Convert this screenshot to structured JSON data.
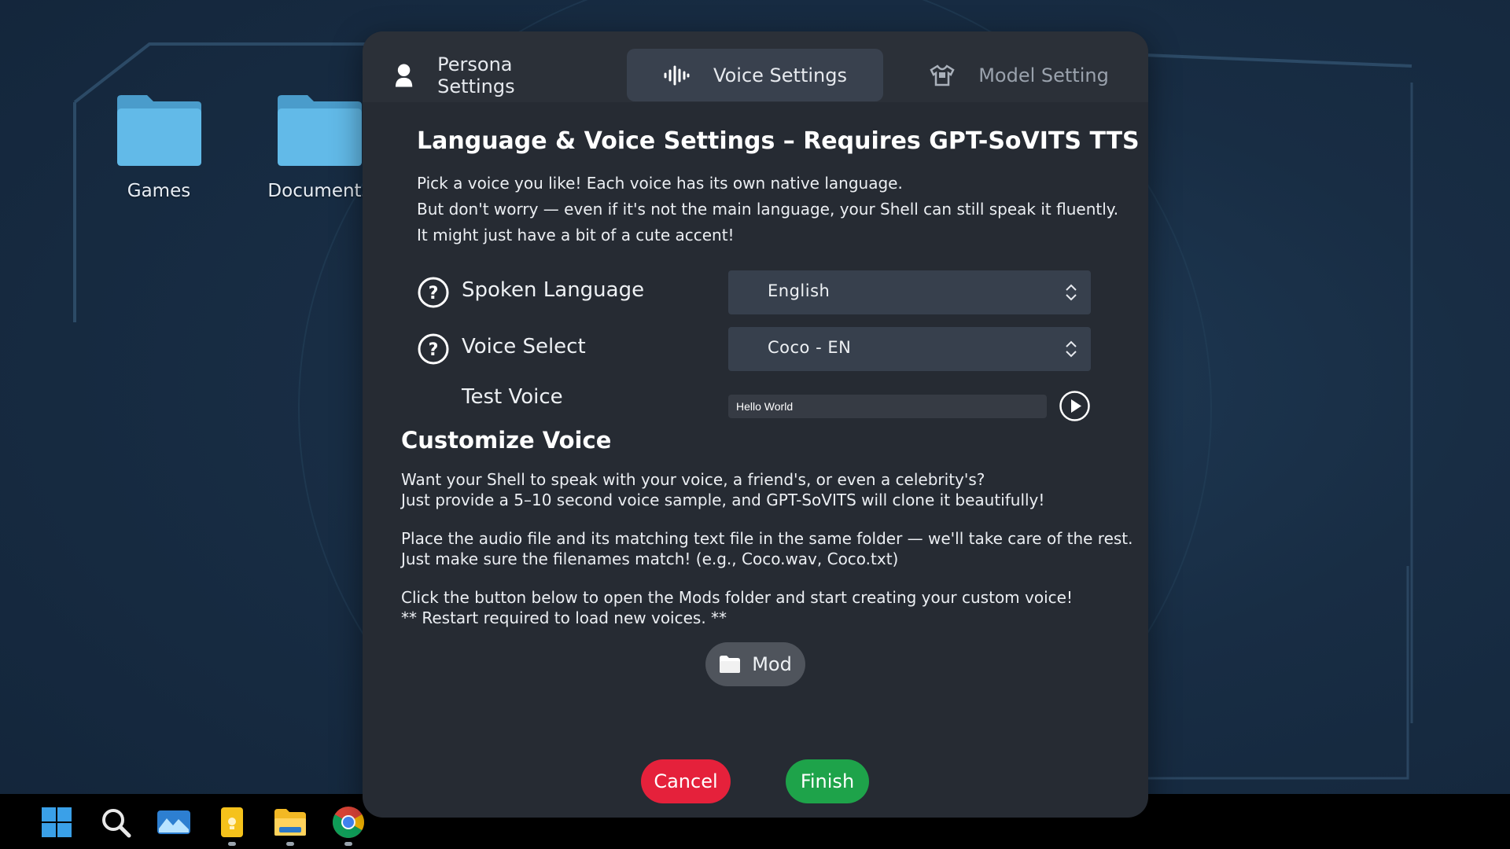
{
  "desktop": {
    "icons": [
      {
        "label": "Games"
      },
      {
        "label": "Documents"
      }
    ]
  },
  "taskbar": {
    "items": [
      "windows-start-icon",
      "search-icon",
      "photos-app-icon",
      "notes-app-icon",
      "file-explorer-icon",
      "chrome-browser-icon"
    ]
  },
  "tabs": [
    {
      "label": "Persona Settings",
      "icon": "person-icon"
    },
    {
      "label": "Voice Settings",
      "icon": "soundwave-icon",
      "active": true
    },
    {
      "label": "Model Setting",
      "icon": "shirt-icon"
    }
  ],
  "voice": {
    "title": "Language & Voice Settings – Requires GPT-SoVITS TTS",
    "intro": [
      "Pick a voice you like! Each voice has its own native language.",
      "But don't worry — even if it's not the main language, your Shell can still speak it fluently.",
      "It might just have a bit of a cute accent!"
    ],
    "spoken_language": {
      "label": "Spoken Language",
      "value": "English"
    },
    "voice_select": {
      "label": "Voice Select",
      "value": "Coco - EN"
    },
    "test_voice": {
      "label": "Test Voice",
      "value": "Hello World"
    }
  },
  "customize": {
    "title": "Customize Voice",
    "paragraphs": [
      [
        "Want your Shell to speak with your voice, a friend's, or even a celebrity's?",
        "Just provide a 5–10 second voice sample, and GPT-SoVITS will clone it beautifully!"
      ],
      [
        "Place the audio file and its matching text file in the same folder — we'll take care of the rest.",
        "Just make sure the filenames match! (e.g., Coco.wav, Coco.txt)"
      ],
      [
        "Click the button below to open the Mods folder and start creating your custom voice!",
        "** Restart required to load new voices. **"
      ]
    ],
    "mod_button": "Mod"
  },
  "footer": {
    "cancel": "Cancel",
    "finish": "Finish"
  },
  "colors": {
    "dialog_bg": "#262b33",
    "active_tab": "#39414e",
    "cancel": "#e5213b",
    "finish": "#1ea34a",
    "folder": "#5fb8e6"
  }
}
